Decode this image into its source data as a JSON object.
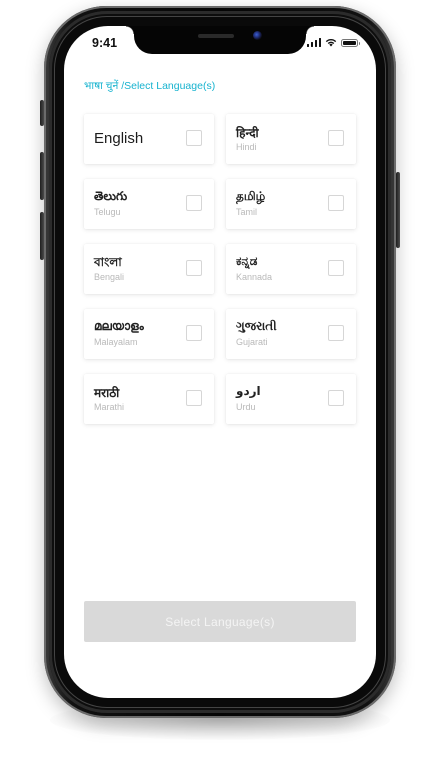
{
  "status_bar": {
    "time": "9:41",
    "icons": [
      "signal-icon",
      "wifi-icon",
      "battery-icon"
    ]
  },
  "heading": "भाषा चुनें /Select Language(s)",
  "languages": [
    {
      "native": "English",
      "english": ""
    },
    {
      "native": "हिन्दी",
      "english": "Hindi"
    },
    {
      "native": "తెలుగు",
      "english": "Telugu"
    },
    {
      "native": "தமிழ்",
      "english": "Tamil"
    },
    {
      "native": "বাংলা",
      "english": "Bengali"
    },
    {
      "native": "ಕನ್ನಡ",
      "english": "Kannada"
    },
    {
      "native": "മലയാളം",
      "english": "Malayalam"
    },
    {
      "native": "ગુજરાતી",
      "english": "Gujarati"
    },
    {
      "native": "मराठी",
      "english": "Marathi"
    },
    {
      "native": "اردو",
      "english": "Urdu"
    }
  ],
  "submit_label": "Select Language(s)",
  "colors": {
    "accent": "#17b3cf",
    "disabled_button": "#d9d9d9",
    "checkbox_border": "#d6d6d6"
  }
}
